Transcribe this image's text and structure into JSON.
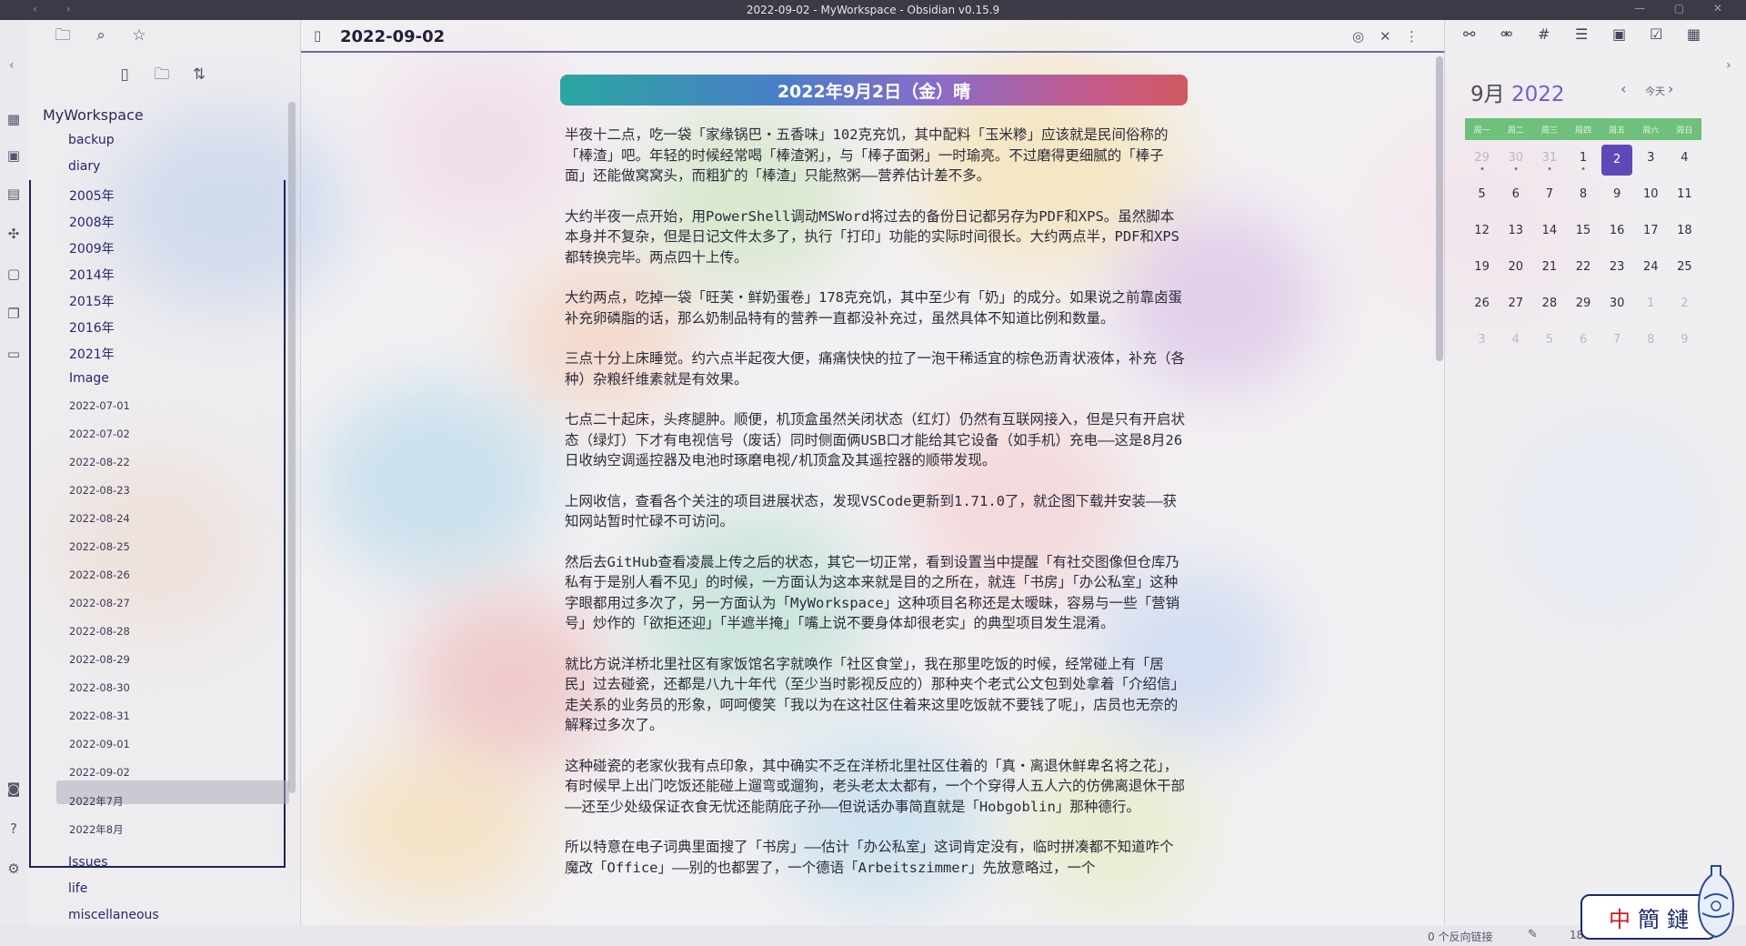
{
  "window": {
    "title": "2022-09-02 - MyWorkspace - Obsidian v0.15.9"
  },
  "ribbon": {
    "icons": [
      "table-icon",
      "calendar-check-icon",
      "note-icon",
      "graph-icon",
      "daily-note-icon",
      "copy-icon",
      "cards-icon",
      "camera-icon",
      "help-icon",
      "settings-icon"
    ]
  },
  "sidebar": {
    "top_icons": [
      "folder-icon",
      "search-icon",
      "star-icon"
    ],
    "action_icons": [
      "new-note-icon",
      "new-folder-icon",
      "sort-icon"
    ],
    "vault_name": "MyWorkspace",
    "folders_top": [
      "backup",
      "diary"
    ],
    "diary_subfolders": [
      "2005年",
      "2008年",
      "2009年",
      "2014年",
      "2015年",
      "2016年",
      "2021年",
      "Image"
    ],
    "diary_files": [
      "2022-07-01",
      "2022-07-02",
      "2022-08-22",
      "2022-08-23",
      "2022-08-24",
      "2022-08-25",
      "2022-08-26",
      "2022-08-27",
      "2022-08-28",
      "2022-08-29",
      "2022-08-30",
      "2022-08-31",
      "2022-09-01",
      "2022-09-02",
      "2022年7月",
      "2022年8月"
    ],
    "folders_bottom": [
      "Issues",
      "life",
      "miscellaneous"
    ]
  },
  "editor": {
    "tab_title": "2022-09-02",
    "headline": "2022年9月2日（金）晴",
    "paragraphs": [
      "半夜十二点，吃一袋「家缘锅巴・五香味」102克充饥，其中配料「玉米糁」应该就是民间俗称的「棒渣」吧。年轻的时候经常喝「棒渣粥」，与「棒子面粥」一时瑜亮。不过磨得更细腻的「棒子面」还能做窝窝头，而粗犷的「棒渣」只能熬粥——营养估计差不多。",
      "大约半夜一点开始，用PowerShell调动MSWord将过去的备份日记都另存为PDF和XPS。虽然脚本本身并不复杂，但是日记文件太多了，执行「打印」功能的实际时间很长。大约两点半，PDF和XPS都转换完毕。两点四十上传。",
      "大约两点，吃掉一袋「旺芙・鲜奶蛋卷」178克充饥，其中至少有「奶」的成分。如果说之前靠卤蛋补充卵磷脂的话，那么奶制品特有的营养一直都没补充过，虽然具体不知道比例和数量。",
      "三点十分上床睡觉。约六点半起夜大便，痛痛快快的拉了一泡干稀适宜的棕色沥青状液体，补充（各种）杂粮纤维素就是有效果。",
      "七点二十起床，头疼腿肿。顺便，机顶盒虽然关闭状态（红灯）仍然有互联网接入，但是只有开启状态（绿灯）下才有电视信号（废话）同时侧面俩USB口才能给其它设备（如手机）充电——这是8月26日收纳空调遥控器及电池时琢磨电视/机顶盒及其遥控器的顺带发现。",
      "上网收信，查看各个关注的项目进展状态，发现VSCode更新到1.71.0了，就企图下载并安装——获知网站暂时忙碌不可访问。",
      "然后去GitHub查看凌晨上传之后的状态，其它一切正常，看到设置当中提醒「有社交图像但仓库乃私有于是别人看不见」的时候，一方面认为这本来就是目的之所在，就连「书房」「办公私室」这种字眼都用过多次了，另一方面认为「MyWorkspace」这种项目名称还是太暧昧，容易与一些「营销号」炒作的「欲拒还迎」「半遮半掩」「嘴上说不要身体却很老实」的典型项目发生混淆。",
      "就比方说洋桥北里社区有家饭馆名字就唤作「社区食堂」，我在那里吃饭的时候，经常碰上有「居民」过去碰瓷，还都是八九十年代（至少当时影视反应的）那种夹个老式公文包到处拿着「介绍信」走关系的业务员的形象，呵呵傻笑「我以为在这社区住着来这里吃饭就不要钱了呢」，店员也无奈的解释过多次了。",
      "这种碰瓷的老家伙我有点印象，其中确实不乏在洋桥北里社区住着的「真・离退休鲜卑名将之花」，有时候早上出门吃饭还能碰上遛弯或遛狗，老头老太太都有，一个个穿得人五人六的仿佛离退休干部——还至少处级保证衣食无忧还能荫庇子孙——但说话办事简直就是「Hobgoblin」那种德行。",
      "所以特意在电子词典里面搜了「书房」——估计「办公私室」这词肯定没有，临时拼凑都不知道咋个魔改「Office」——别的也都罢了，一个德语「Arbeitszimmer」先放意略过，一个"
    ]
  },
  "calendar": {
    "month": "9月",
    "year": "2022",
    "today_label": "今天",
    "weekdays": [
      "周一",
      "周二",
      "周三",
      "周四",
      "周五",
      "周六",
      "周日"
    ],
    "days": [
      [
        "29",
        "30",
        "31",
        "1",
        "2",
        "3",
        "4"
      ],
      [
        "5",
        "6",
        "7",
        "8",
        "9",
        "10",
        "11"
      ],
      [
        "12",
        "13",
        "14",
        "15",
        "16",
        "17",
        "18"
      ],
      [
        "19",
        "20",
        "21",
        "22",
        "23",
        "24",
        "25"
      ],
      [
        "26",
        "27",
        "28",
        "29",
        "30",
        "1",
        "2"
      ],
      [
        "3",
        "4",
        "5",
        "6",
        "7",
        "8",
        "9"
      ]
    ],
    "selected_day": "2"
  },
  "statusbar": {
    "backlinks": "0 个反向链接",
    "count": "18"
  },
  "stamp": {
    "text": "中簡鏈"
  }
}
